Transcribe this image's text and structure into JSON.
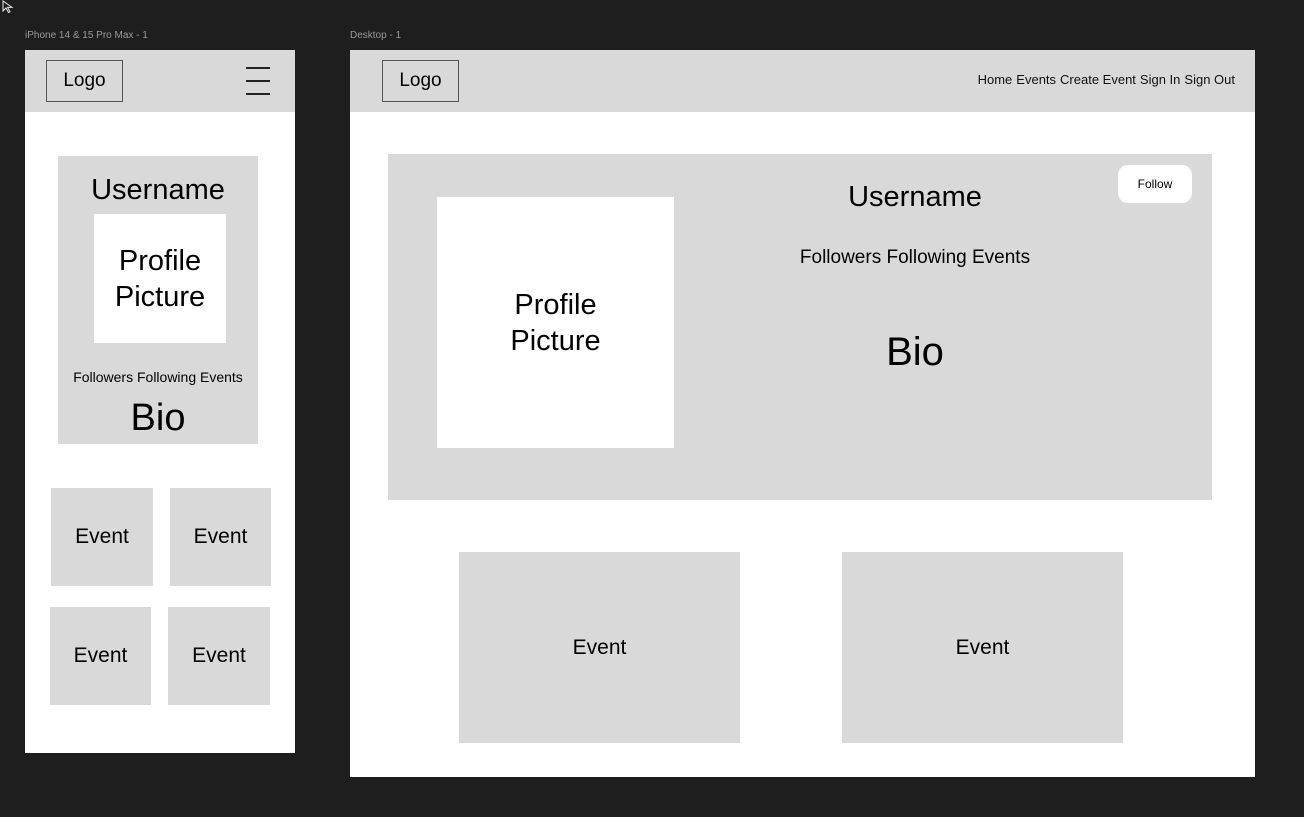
{
  "canvas": {
    "mobile_frame_label": "iPhone 14 & 15 Pro Max - 1",
    "desktop_frame_label": "Desktop - 1"
  },
  "mobile": {
    "logo": "Logo",
    "menu_icon": "hamburger-menu-icon",
    "profile": {
      "username": "Username",
      "picture": "Profile Picture",
      "stats": "Followers Following Events",
      "bio": "Bio"
    },
    "events": [
      "Event",
      "Event",
      "Event",
      "Event"
    ]
  },
  "desktop": {
    "logo": "Logo",
    "nav": [
      "Home",
      "Events",
      "Create Event",
      "Sign In",
      "Sign Out"
    ],
    "profile": {
      "username": "Username",
      "picture": "Profile Picture",
      "stats": "Followers Following Events",
      "bio": "Bio",
      "follow_label": "Follow"
    },
    "events": [
      "Event",
      "Event"
    ]
  },
  "colors": {
    "canvas_bg": "#1e1e1e",
    "frame_bg": "#ffffff",
    "placeholder_grey": "#d9d9d9"
  }
}
